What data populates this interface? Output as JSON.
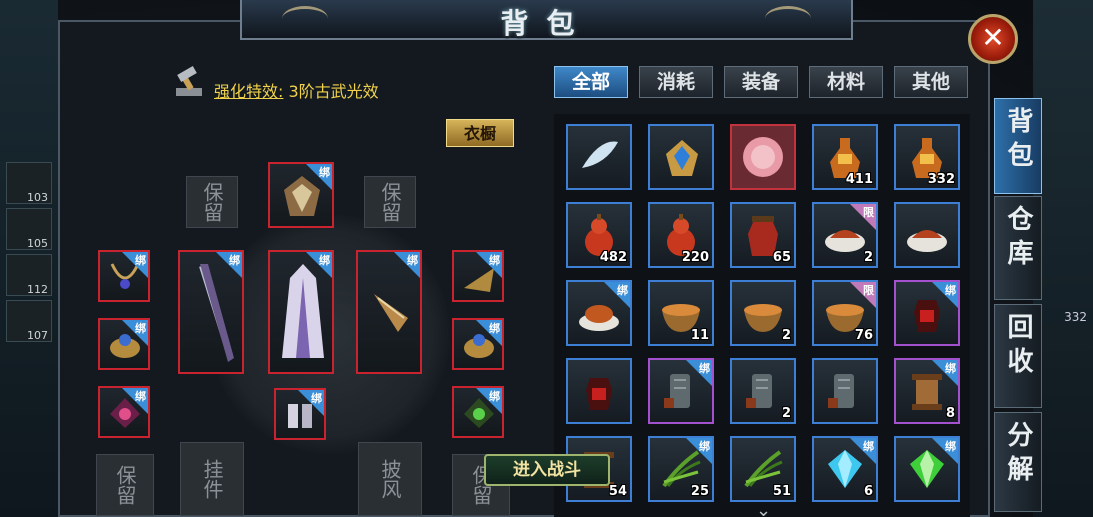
{
  "window": {
    "title": "背包",
    "close_label": "✕"
  },
  "left": {
    "enhance_label": "强化特效:",
    "enhance_value": "3阶古武光效",
    "wardrobe_label": "衣橱",
    "bind_label": "绑",
    "placeholder_top_left": "保留",
    "placeholder_top_right": "保留",
    "placeholder_bottom_1": "保留",
    "placeholder_bottom_2": "挂件",
    "placeholder_bottom_3": "披风",
    "placeholder_bottom_4": "保留"
  },
  "tabs": [
    {
      "label": "全部",
      "active": true
    },
    {
      "label": "消耗",
      "active": false
    },
    {
      "label": "装备",
      "active": false
    },
    {
      "label": "材料",
      "active": false
    },
    {
      "label": "其他",
      "active": false
    }
  ],
  "side_tabs": [
    {
      "label": "背包",
      "active": true
    },
    {
      "label": "仓库",
      "active": false
    },
    {
      "label": "回收",
      "active": false
    },
    {
      "label": "分解",
      "active": false
    }
  ],
  "items": [
    {
      "icon": "feather-icon",
      "count": "",
      "badge": "",
      "border": "blue"
    },
    {
      "icon": "helmet-icon",
      "count": "",
      "badge": "",
      "border": "blue"
    },
    {
      "icon": "pink-fur-ball-icon",
      "count": "",
      "badge": "",
      "border": "red"
    },
    {
      "icon": "potion-bottle-icon",
      "count": "411",
      "badge": "",
      "border": "blue"
    },
    {
      "icon": "potion-bottle-icon",
      "count": "332",
      "badge": "",
      "border": "blue"
    },
    {
      "icon": "gourd-icon",
      "count": "482",
      "badge": "",
      "border": "blue"
    },
    {
      "icon": "gourd-icon",
      "count": "220",
      "badge": "",
      "border": "blue"
    },
    {
      "icon": "wine-jar-icon",
      "count": "65",
      "badge": "",
      "border": "blue"
    },
    {
      "icon": "meat-dish-icon",
      "count": "2",
      "badge": "限",
      "border": "blue"
    },
    {
      "icon": "meat-dish-icon",
      "count": "",
      "badge": "",
      "border": "blue"
    },
    {
      "icon": "roast-chicken-icon",
      "count": "",
      "badge": "绑",
      "border": "blue"
    },
    {
      "icon": "soup-bowl-icon",
      "count": "11",
      "badge": "",
      "border": "blue"
    },
    {
      "icon": "soup-bowl-icon",
      "count": "2",
      "badge": "",
      "border": "blue"
    },
    {
      "icon": "soup-bowl-icon",
      "count": "76",
      "badge": "限",
      "border": "blue"
    },
    {
      "icon": "red-jar-icon",
      "count": "",
      "badge": "绑",
      "border": "purple"
    },
    {
      "icon": "red-jar-icon",
      "count": "",
      "badge": "",
      "border": "blue"
    },
    {
      "icon": "stone-tablet-icon",
      "count": "",
      "badge": "绑",
      "border": "purple"
    },
    {
      "icon": "stone-tablet-icon",
      "count": "2",
      "badge": "",
      "border": "blue"
    },
    {
      "icon": "stone-tablet-icon",
      "count": "",
      "badge": "",
      "border": "blue"
    },
    {
      "icon": "scroll-icon",
      "count": "8",
      "badge": "绑",
      "border": "purple"
    },
    {
      "icon": "scroll-icon",
      "count": "54",
      "badge": "",
      "border": "blue"
    },
    {
      "icon": "herb-icon",
      "count": "25",
      "badge": "绑",
      "border": "blue"
    },
    {
      "icon": "herb-icon",
      "count": "51",
      "badge": "",
      "border": "blue"
    },
    {
      "icon": "blue-gem-icon",
      "count": "6",
      "badge": "绑",
      "border": "blue"
    },
    {
      "icon": "green-gem-icon",
      "count": "",
      "badge": "绑",
      "border": "blue"
    }
  ],
  "bottom": {
    "battle_label": "进入战斗"
  },
  "side_world": {
    "nums": [
      "103",
      "105",
      "112",
      "107"
    ],
    "right_num": "332"
  },
  "colors": {
    "accent_blue": "#3d7fd4",
    "equip_red": "#c9232f",
    "enhance_gold": "#f1d24a"
  }
}
